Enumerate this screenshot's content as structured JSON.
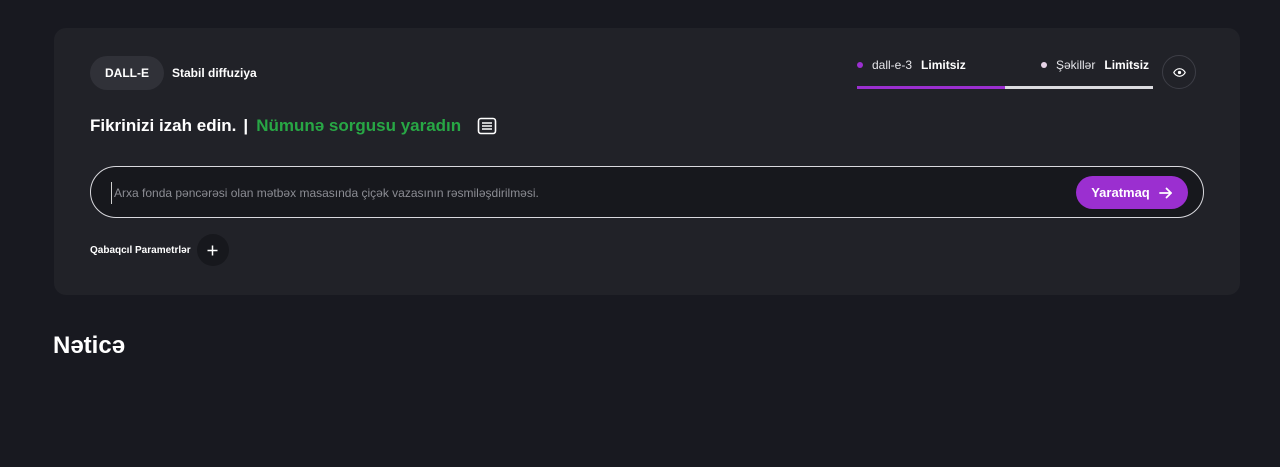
{
  "model_tabs": [
    {
      "label": "DALL-E",
      "active": true
    },
    {
      "label": "Stabil diffuziya",
      "active": false
    }
  ],
  "limits": [
    {
      "name": "dall-e-3",
      "value": "Limitsiz",
      "dot_color": "#9b2fd0",
      "bar_color": "#9b2fd0"
    },
    {
      "name": "Şəkillər",
      "value": "Limitsiz",
      "dot_color": "#e6d3e6",
      "bar_color": "#dcdce0"
    }
  ],
  "eye_button": {
    "icon": "eye-icon"
  },
  "heading": {
    "prompt_label": "Fikrinizi izah edin.",
    "separator": "|",
    "generate_link": "Nümunə sorgusu yaradın",
    "doc_icon": "document-lines-icon"
  },
  "prompt": {
    "value": "",
    "placeholder": "Arxa fonda pəncərəsi olan mətbəx masasında çiçək vazasının rəsmiləşdirilməsi."
  },
  "generate_button": {
    "label": "Yaratmaq",
    "icon": "arrow-right-icon"
  },
  "advanced": {
    "label": "Qabaqcıl Parametrlər",
    "icon": "plus-icon"
  },
  "result": {
    "title": "Nəticə"
  },
  "colors": {
    "background": "#181920",
    "card": "#212228",
    "accent": "#9b2fd0",
    "link_green": "#28a745"
  }
}
